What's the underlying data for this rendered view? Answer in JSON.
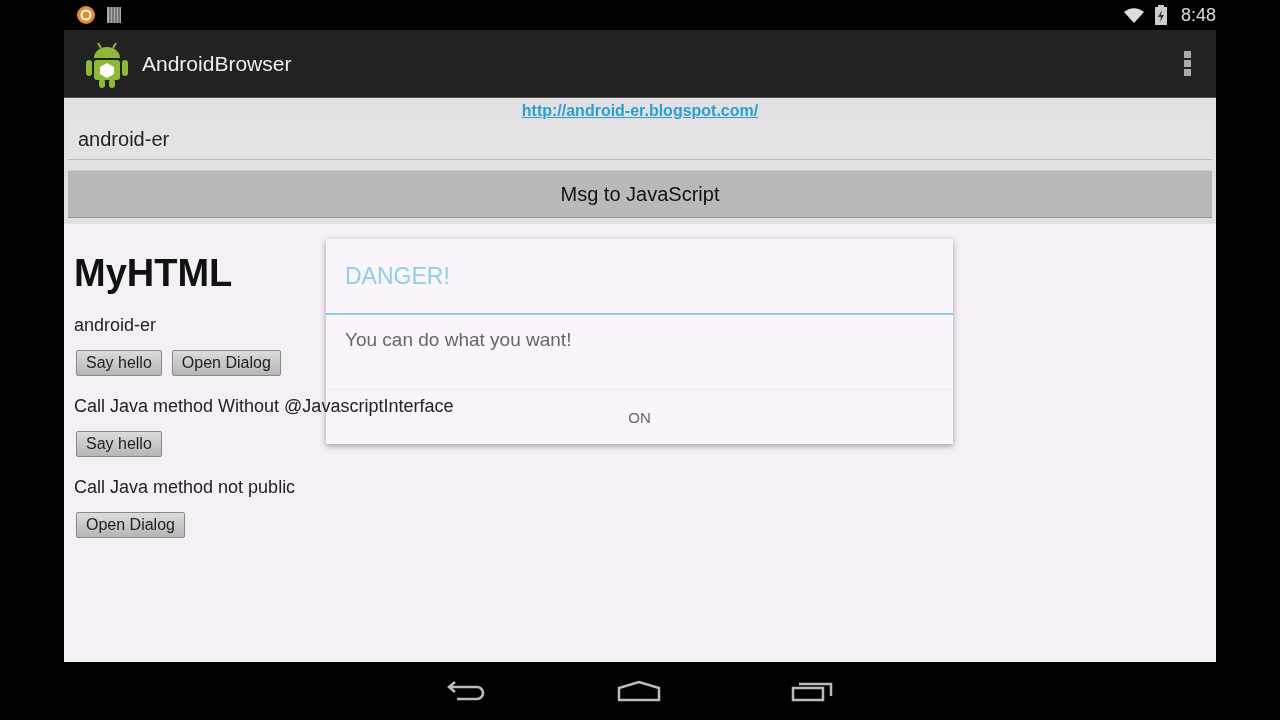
{
  "status_bar": {
    "time": "8:48"
  },
  "action_bar": {
    "title": "AndroidBrowser"
  },
  "url_link": "http://android-er.blogspot.com/",
  "message_field": {
    "value": "android-er"
  },
  "send_button": "Msg to JavaScript",
  "webpage": {
    "heading": "MyHTML",
    "sections": [
      {
        "text": "android-er",
        "buttons": [
          "Say hello",
          "Open Dialog"
        ]
      },
      {
        "text": "Call Java method Without @JavascriptInterface",
        "buttons": [
          "Say hello"
        ]
      },
      {
        "text": "Call Java method not public",
        "buttons": [
          "Open Dialog"
        ]
      }
    ]
  },
  "dialog": {
    "title": "DANGER!",
    "message": "You can do what you want!",
    "button": "ON"
  }
}
